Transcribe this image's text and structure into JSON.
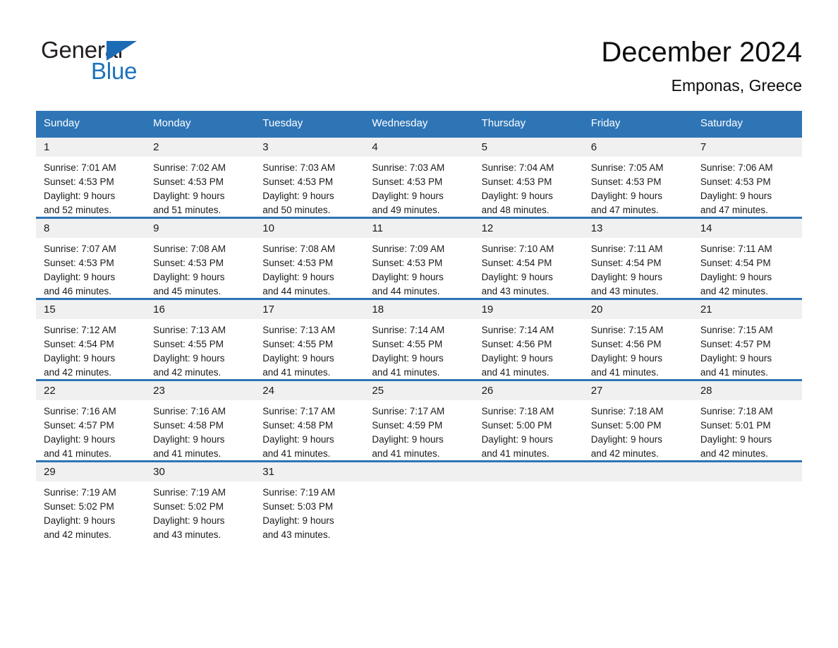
{
  "brand": {
    "name_part1": "General",
    "name_part2": "Blue",
    "triangle_color": "#1c6cb5",
    "blue_color": "#1c72bb"
  },
  "header": {
    "title": "December 2024",
    "subtitle": "Emponas, Greece"
  },
  "theme": {
    "header_bg": "#2e75b6",
    "daynum_bg": "#f0f0f0",
    "row_rule": "#2e75b6",
    "text": "#1a1a1a"
  },
  "calendar": {
    "weekday_headers": [
      "Sunday",
      "Monday",
      "Tuesday",
      "Wednesday",
      "Thursday",
      "Friday",
      "Saturday"
    ],
    "weeks": [
      [
        {
          "day": "1",
          "sunrise": "Sunrise: 7:01 AM",
          "sunset": "Sunset: 4:53 PM",
          "daylight_line1": "Daylight: 9 hours",
          "daylight_line2": "and 52 minutes."
        },
        {
          "day": "2",
          "sunrise": "Sunrise: 7:02 AM",
          "sunset": "Sunset: 4:53 PM",
          "daylight_line1": "Daylight: 9 hours",
          "daylight_line2": "and 51 minutes."
        },
        {
          "day": "3",
          "sunrise": "Sunrise: 7:03 AM",
          "sunset": "Sunset: 4:53 PM",
          "daylight_line1": "Daylight: 9 hours",
          "daylight_line2": "and 50 minutes."
        },
        {
          "day": "4",
          "sunrise": "Sunrise: 7:03 AM",
          "sunset": "Sunset: 4:53 PM",
          "daylight_line1": "Daylight: 9 hours",
          "daylight_line2": "and 49 minutes."
        },
        {
          "day": "5",
          "sunrise": "Sunrise: 7:04 AM",
          "sunset": "Sunset: 4:53 PM",
          "daylight_line1": "Daylight: 9 hours",
          "daylight_line2": "and 48 minutes."
        },
        {
          "day": "6",
          "sunrise": "Sunrise: 7:05 AM",
          "sunset": "Sunset: 4:53 PM",
          "daylight_line1": "Daylight: 9 hours",
          "daylight_line2": "and 47 minutes."
        },
        {
          "day": "7",
          "sunrise": "Sunrise: 7:06 AM",
          "sunset": "Sunset: 4:53 PM",
          "daylight_line1": "Daylight: 9 hours",
          "daylight_line2": "and 47 minutes."
        }
      ],
      [
        {
          "day": "8",
          "sunrise": "Sunrise: 7:07 AM",
          "sunset": "Sunset: 4:53 PM",
          "daylight_line1": "Daylight: 9 hours",
          "daylight_line2": "and 46 minutes."
        },
        {
          "day": "9",
          "sunrise": "Sunrise: 7:08 AM",
          "sunset": "Sunset: 4:53 PM",
          "daylight_line1": "Daylight: 9 hours",
          "daylight_line2": "and 45 minutes."
        },
        {
          "day": "10",
          "sunrise": "Sunrise: 7:08 AM",
          "sunset": "Sunset: 4:53 PM",
          "daylight_line1": "Daylight: 9 hours",
          "daylight_line2": "and 44 minutes."
        },
        {
          "day": "11",
          "sunrise": "Sunrise: 7:09 AM",
          "sunset": "Sunset: 4:53 PM",
          "daylight_line1": "Daylight: 9 hours",
          "daylight_line2": "and 44 minutes."
        },
        {
          "day": "12",
          "sunrise": "Sunrise: 7:10 AM",
          "sunset": "Sunset: 4:54 PM",
          "daylight_line1": "Daylight: 9 hours",
          "daylight_line2": "and 43 minutes."
        },
        {
          "day": "13",
          "sunrise": "Sunrise: 7:11 AM",
          "sunset": "Sunset: 4:54 PM",
          "daylight_line1": "Daylight: 9 hours",
          "daylight_line2": "and 43 minutes."
        },
        {
          "day": "14",
          "sunrise": "Sunrise: 7:11 AM",
          "sunset": "Sunset: 4:54 PM",
          "daylight_line1": "Daylight: 9 hours",
          "daylight_line2": "and 42 minutes."
        }
      ],
      [
        {
          "day": "15",
          "sunrise": "Sunrise: 7:12 AM",
          "sunset": "Sunset: 4:54 PM",
          "daylight_line1": "Daylight: 9 hours",
          "daylight_line2": "and 42 minutes."
        },
        {
          "day": "16",
          "sunrise": "Sunrise: 7:13 AM",
          "sunset": "Sunset: 4:55 PM",
          "daylight_line1": "Daylight: 9 hours",
          "daylight_line2": "and 42 minutes."
        },
        {
          "day": "17",
          "sunrise": "Sunrise: 7:13 AM",
          "sunset": "Sunset: 4:55 PM",
          "daylight_line1": "Daylight: 9 hours",
          "daylight_line2": "and 41 minutes."
        },
        {
          "day": "18",
          "sunrise": "Sunrise: 7:14 AM",
          "sunset": "Sunset: 4:55 PM",
          "daylight_line1": "Daylight: 9 hours",
          "daylight_line2": "and 41 minutes."
        },
        {
          "day": "19",
          "sunrise": "Sunrise: 7:14 AM",
          "sunset": "Sunset: 4:56 PM",
          "daylight_line1": "Daylight: 9 hours",
          "daylight_line2": "and 41 minutes."
        },
        {
          "day": "20",
          "sunrise": "Sunrise: 7:15 AM",
          "sunset": "Sunset: 4:56 PM",
          "daylight_line1": "Daylight: 9 hours",
          "daylight_line2": "and 41 minutes."
        },
        {
          "day": "21",
          "sunrise": "Sunrise: 7:15 AM",
          "sunset": "Sunset: 4:57 PM",
          "daylight_line1": "Daylight: 9 hours",
          "daylight_line2": "and 41 minutes."
        }
      ],
      [
        {
          "day": "22",
          "sunrise": "Sunrise: 7:16 AM",
          "sunset": "Sunset: 4:57 PM",
          "daylight_line1": "Daylight: 9 hours",
          "daylight_line2": "and 41 minutes."
        },
        {
          "day": "23",
          "sunrise": "Sunrise: 7:16 AM",
          "sunset": "Sunset: 4:58 PM",
          "daylight_line1": "Daylight: 9 hours",
          "daylight_line2": "and 41 minutes."
        },
        {
          "day": "24",
          "sunrise": "Sunrise: 7:17 AM",
          "sunset": "Sunset: 4:58 PM",
          "daylight_line1": "Daylight: 9 hours",
          "daylight_line2": "and 41 minutes."
        },
        {
          "day": "25",
          "sunrise": "Sunrise: 7:17 AM",
          "sunset": "Sunset: 4:59 PM",
          "daylight_line1": "Daylight: 9 hours",
          "daylight_line2": "and 41 minutes."
        },
        {
          "day": "26",
          "sunrise": "Sunrise: 7:18 AM",
          "sunset": "Sunset: 5:00 PM",
          "daylight_line1": "Daylight: 9 hours",
          "daylight_line2": "and 41 minutes."
        },
        {
          "day": "27",
          "sunrise": "Sunrise: 7:18 AM",
          "sunset": "Sunset: 5:00 PM",
          "daylight_line1": "Daylight: 9 hours",
          "daylight_line2": "and 42 minutes."
        },
        {
          "day": "28",
          "sunrise": "Sunrise: 7:18 AM",
          "sunset": "Sunset: 5:01 PM",
          "daylight_line1": "Daylight: 9 hours",
          "daylight_line2": "and 42 minutes."
        }
      ],
      [
        {
          "day": "29",
          "sunrise": "Sunrise: 7:19 AM",
          "sunset": "Sunset: 5:02 PM",
          "daylight_line1": "Daylight: 9 hours",
          "daylight_line2": "and 42 minutes."
        },
        {
          "day": "30",
          "sunrise": "Sunrise: 7:19 AM",
          "sunset": "Sunset: 5:02 PM",
          "daylight_line1": "Daylight: 9 hours",
          "daylight_line2": "and 43 minutes."
        },
        {
          "day": "31",
          "sunrise": "Sunrise: 7:19 AM",
          "sunset": "Sunset: 5:03 PM",
          "daylight_line1": "Daylight: 9 hours",
          "daylight_line2": "and 43 minutes."
        },
        {
          "day": "",
          "sunrise": "",
          "sunset": "",
          "daylight_line1": "",
          "daylight_line2": ""
        },
        {
          "day": "",
          "sunrise": "",
          "sunset": "",
          "daylight_line1": "",
          "daylight_line2": ""
        },
        {
          "day": "",
          "sunrise": "",
          "sunset": "",
          "daylight_line1": "",
          "daylight_line2": ""
        },
        {
          "day": "",
          "sunrise": "",
          "sunset": "",
          "daylight_line1": "",
          "daylight_line2": ""
        }
      ]
    ]
  }
}
